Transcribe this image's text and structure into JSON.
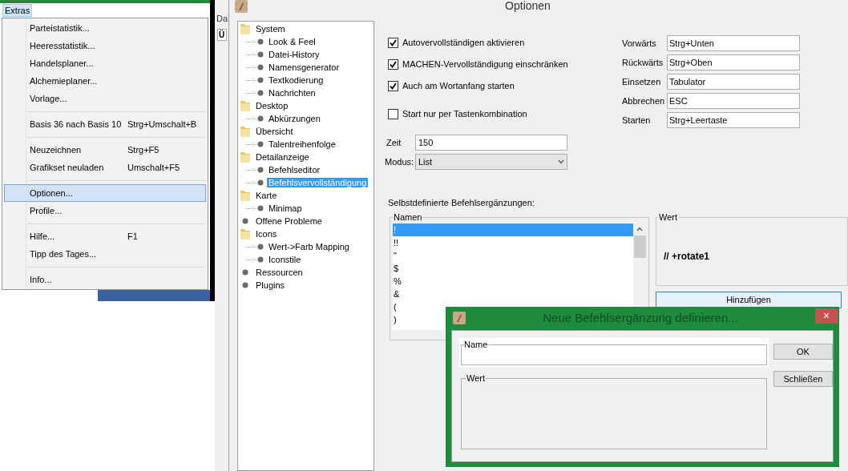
{
  "background_app": {
    "title_fragment": "Da",
    "tab_fragment": "Ü"
  },
  "menu_bar": {
    "menus": [
      {
        "label": "Extras",
        "selected": true
      }
    ]
  },
  "menu": {
    "items": [
      {
        "kind": "item",
        "label": "Parteistatistik...",
        "selected": false
      },
      {
        "kind": "item",
        "label": "Heeresstatistik...",
        "selected": false
      },
      {
        "kind": "item",
        "label": "Handelsplaner...",
        "selected": false
      },
      {
        "kind": "item",
        "label": "Alchemieplaner...",
        "selected": false
      },
      {
        "kind": "item",
        "label": "Vorlage...",
        "selected": false
      },
      {
        "kind": "separator"
      },
      {
        "kind": "item",
        "label": "Basis 36 nach Basis 10",
        "shortcut": "Strg+Umschalt+B",
        "selected": false
      },
      {
        "kind": "separator"
      },
      {
        "kind": "item",
        "label": "Neuzeichnen",
        "shortcut": "Strg+F5",
        "selected": false
      },
      {
        "kind": "item",
        "label": "Grafikset neuladen",
        "shortcut": "Umschalt+F5",
        "selected": false
      },
      {
        "kind": "separator"
      },
      {
        "kind": "item",
        "label": "Optionen...",
        "selected": true
      },
      {
        "kind": "item",
        "label": "Profile...",
        "selected": false
      },
      {
        "kind": "separator"
      },
      {
        "kind": "item",
        "label": "Hilfe...",
        "shortcut": "F1",
        "selected": false
      },
      {
        "kind": "item",
        "label": "Tipp des Tages...",
        "selected": false
      },
      {
        "kind": "separator"
      },
      {
        "kind": "item",
        "label": "Info...",
        "selected": false
      }
    ]
  },
  "options_window": {
    "title": "Optionen",
    "tree": [
      {
        "kind": "folder",
        "label": "System",
        "selected": false,
        "children": [
          {
            "kind": "leaf",
            "label": "Look & Feel",
            "selected": false
          },
          {
            "kind": "leaf",
            "label": "Datei-History",
            "selected": false
          },
          {
            "kind": "leaf",
            "label": "Namensgenerator",
            "selected": false
          },
          {
            "kind": "leaf",
            "label": "Textkodierung",
            "selected": false
          },
          {
            "kind": "leaf",
            "label": "Nachrichten",
            "selected": false
          }
        ]
      },
      {
        "kind": "folder",
        "label": "Desktop",
        "selected": false,
        "children": [
          {
            "kind": "leaf",
            "label": "Abkürzungen",
            "selected": false
          }
        ]
      },
      {
        "kind": "folder",
        "label": "Übersicht",
        "selected": false,
        "children": [
          {
            "kind": "leaf",
            "label": "Talentreihenfolge",
            "selected": false
          }
        ]
      },
      {
        "kind": "folder",
        "label": "Detailanzeige",
        "selected": false,
        "children": [
          {
            "kind": "leaf",
            "label": "Befehlseditor",
            "selected": false
          },
          {
            "kind": "leaf",
            "label": "Befehlsvervollständigung",
            "selected": true
          }
        ]
      },
      {
        "kind": "folder",
        "label": "Karte",
        "selected": false,
        "children": [
          {
            "kind": "leaf",
            "label": "Minimap",
            "selected": false
          }
        ]
      },
      {
        "kind": "leaf",
        "label": "Offene Probleme",
        "selected": false
      },
      {
        "kind": "folder",
        "label": "Icons",
        "selected": false,
        "children": [
          {
            "kind": "leaf",
            "label": "Wert->Farb Mapping",
            "selected": false
          },
          {
            "kind": "leaf",
            "label": "Iconstile",
            "selected": false
          }
        ]
      },
      {
        "kind": "leaf",
        "label": "Ressourcen",
        "selected": false
      },
      {
        "kind": "leaf",
        "label": "Plugins",
        "selected": false
      }
    ],
    "checkboxes": [
      {
        "label": "Autovervollständigen aktivieren",
        "checked": true
      },
      {
        "label": "MACHEN-Vervollständigung einschränken",
        "checked": true
      },
      {
        "label": "Auch am Wortanfang starten",
        "checked": true
      },
      {
        "label": "Start nur per Tastenkombination",
        "checked": false
      }
    ],
    "zeit": {
      "label": "Zeit",
      "value": "150"
    },
    "modus": {
      "label": "Modus:",
      "value": "List"
    },
    "shortcuts": [
      {
        "label": "Vorwärts",
        "value": "Strg+Unten"
      },
      {
        "label": "Rückwärts",
        "value": "Strg+Oben"
      },
      {
        "label": "Einsetzen",
        "value": "Tabulator"
      },
      {
        "label": "Abbrechen",
        "value": "ESC"
      },
      {
        "label": "Starten",
        "value": "Strg+Leertaste"
      }
    ],
    "custom_completions": {
      "heading": "Selbstdefinierte Befehlsergänzungen:",
      "names": {
        "legend": "Namen",
        "items": [
          {
            "label": "!",
            "selected": true
          },
          {
            "label": "!!",
            "selected": false
          },
          {
            "label": "\"",
            "selected": false
          },
          {
            "label": "$",
            "selected": false
          },
          {
            "label": "%",
            "selected": false
          },
          {
            "label": "&",
            "selected": false
          },
          {
            "label": "(",
            "selected": false
          },
          {
            "label": ")",
            "selected": false
          }
        ]
      },
      "value": {
        "legend": "Wert",
        "text": "// +rotate1"
      },
      "add_button": "Hinzufügen"
    }
  },
  "dialog": {
    "title": "Neue Befehlsergänzung definieren...",
    "close": "×",
    "name_field": {
      "legend": "Name"
    },
    "value_field": {
      "legend": "Wert"
    },
    "buttons": [
      "OK",
      "Schließen"
    ]
  }
}
